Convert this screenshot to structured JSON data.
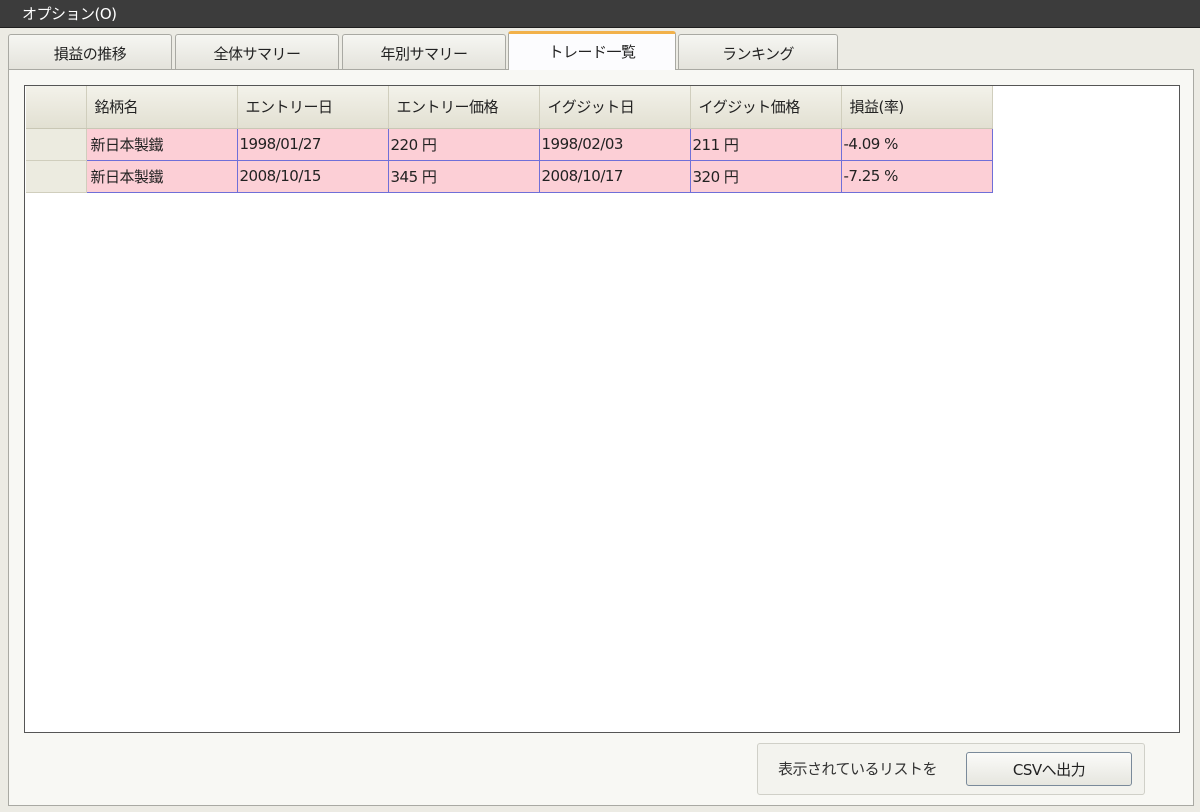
{
  "menu": {
    "options_label": "オプション(O)"
  },
  "tabs": [
    {
      "label": "損益の推移"
    },
    {
      "label": "全体サマリー"
    },
    {
      "label": "年別サマリー"
    },
    {
      "label": "トレード一覧"
    },
    {
      "label": "ランキング"
    }
  ],
  "active_tab": "トレード一覧",
  "table": {
    "columns": [
      "銘柄名",
      "エントリー日",
      "エントリー価格",
      "イグジット日",
      "イグジット価格",
      "損益(率)"
    ],
    "rows": [
      [
        "新日本製鐵",
        "1998/01/27",
        "220 円",
        "1998/02/03",
        "211 円",
        "-4.09 %"
      ],
      [
        "新日本製鐵",
        "2008/10/15",
        "345 円",
        "2008/10/17",
        "320 円",
        "-7.25 %"
      ]
    ]
  },
  "export": {
    "label": "表示されているリストを",
    "button_label": "CSVへ出力"
  },
  "colors": {
    "menubar": "#3c3c3c",
    "active_tab_accent": "#f2b14a",
    "loss_row": "#fccfd6",
    "row_border": "#6f6fd8"
  }
}
